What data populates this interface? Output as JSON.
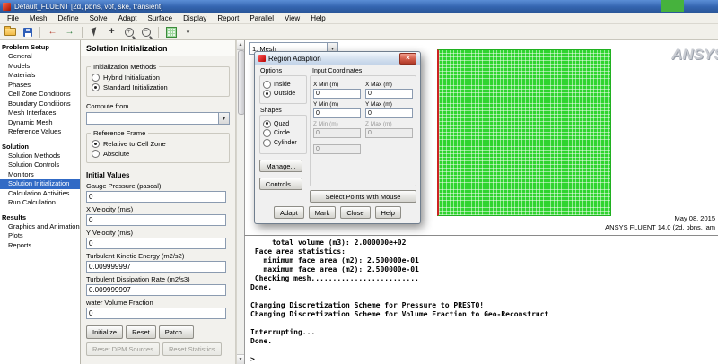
{
  "window": {
    "title": "Default_FLUENT  [2d, pbns, vof, ske, transient]",
    "menus": [
      "File",
      "Mesh",
      "Define",
      "Solve",
      "Adapt",
      "Surface",
      "Display",
      "Report",
      "Parallel",
      "View",
      "Help"
    ]
  },
  "icons": {
    "caret": "▾",
    "close": "×",
    "arrow_up": "▲",
    "arrow_down": "▼",
    "plus": "+",
    "minus": "−",
    "undo_arrow": "←",
    "redo_arrow": "→"
  },
  "tree": {
    "sections": [
      {
        "label": "Problem Setup",
        "items": [
          "General",
          "Models",
          "Materials",
          "Phases",
          "Cell Zone Conditions",
          "Boundary Conditions",
          "Mesh Interfaces",
          "Dynamic Mesh",
          "Reference Values"
        ]
      },
      {
        "label": "Solution",
        "items": [
          "Solution Methods",
          "Solution Controls",
          "Monitors",
          "Solution Initialization",
          "Calculation Activities",
          "Run Calculation"
        ]
      },
      {
        "label": "Results",
        "items": [
          "Graphics and Animations",
          "Plots",
          "Reports"
        ]
      }
    ],
    "selected_item": "Solution Initialization"
  },
  "panel": {
    "title": "Solution Initialization",
    "init_methods": {
      "label": "Initialization Methods",
      "options": [
        "Hybrid Initialization",
        "Standard Initialization"
      ],
      "selected": "Standard Initialization"
    },
    "compute_from": {
      "label": "Compute from",
      "value": ""
    },
    "reference_frame": {
      "label": "Reference Frame",
      "options": [
        "Relative to Cell Zone",
        "Absolute"
      ],
      "selected": "Relative to Cell Zone"
    },
    "initial_values_label": "Initial Values",
    "fields": [
      {
        "label": "Gauge Pressure (pascal)",
        "value": "0"
      },
      {
        "label": "X Velocity (m/s)",
        "value": "0"
      },
      {
        "label": "Y Velocity (m/s)",
        "value": "0"
      },
      {
        "label": "Turbulent Kinetic Energy (m2/s2)",
        "value": "0.009999997"
      },
      {
        "label": "Turbulent Dissipation Rate (m2/s3)",
        "value": "0.009999997"
      },
      {
        "label": "water Volume Fraction",
        "value": "0"
      }
    ],
    "buttons": {
      "initialize": "Initialize",
      "reset": "Reset",
      "patch": "Patch...",
      "reset_dpm": "Reset DPM Sources",
      "reset_stats": "Reset Statistics"
    }
  },
  "dialog": {
    "title": "Region Adaption",
    "options": {
      "label": "Options",
      "items": [
        "Inside",
        "Outside"
      ],
      "selected": "Outside"
    },
    "shapes": {
      "label": "Shapes",
      "items": [
        "Quad",
        "Circle",
        "Cylinder"
      ],
      "selected": "Quad"
    },
    "coords": {
      "label": "Input Coordinates",
      "fields": [
        {
          "label": "X Min (m)",
          "value": "0",
          "enabled": true
        },
        {
          "label": "X Max (m)",
          "value": "0",
          "enabled": true
        },
        {
          "label": "Y Min (m)",
          "value": "0",
          "enabled": true
        },
        {
          "label": "Y Max (m)",
          "value": "0",
          "enabled": true
        },
        {
          "label": "Z Min (m)",
          "value": "0",
          "enabled": false
        },
        {
          "label": "Z Max (m)",
          "value": "0",
          "enabled": false
        }
      ],
      "radius_value": "0"
    },
    "buttons": {
      "manage": "Manage...",
      "controls": "Controls...",
      "select_points": "Select Points with Mouse",
      "adapt": "Adapt",
      "mark": "Mark",
      "close": "Close",
      "help": "Help"
    }
  },
  "graphics": {
    "view_selector": "1: Mesh",
    "brand": "ANSYS",
    "date": "May 08, 2015",
    "caption": "ANSYS FLUENT 14.0 (2d, pbns, lam",
    "mesh_color": "#2fd42f"
  },
  "console": {
    "lines": [
      "     total volume (m3): 2.000000e+02",
      " Face area statistics:",
      "   minimum face area (m2): 2.500000e-01",
      "   maximum face area (m2): 2.500000e-01",
      " Checking mesh.........................",
      "Done.",
      "",
      "Changing Discretization Scheme for Pressure to PRESTO!",
      "Changing Discretization Scheme for Volume Fraction to Geo-Reconstruct",
      "",
      "Interrupting...",
      "Done.",
      "",
      ">"
    ]
  }
}
